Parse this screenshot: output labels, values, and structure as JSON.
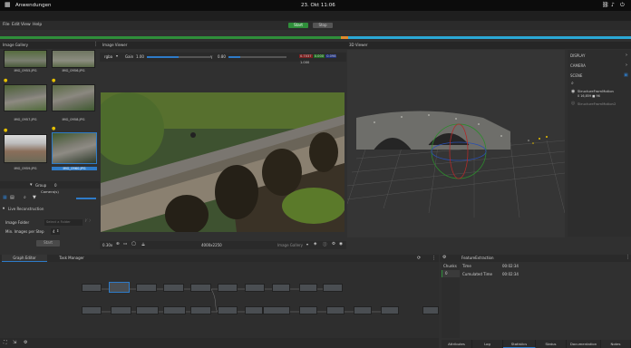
{
  "system": {
    "activities": "Anwendungen",
    "clock": "23. Okt 11:06"
  },
  "menu": [
    "File",
    "Edit",
    "View",
    "Help"
  ],
  "actions": {
    "start": "Start",
    "stop": "Stop"
  },
  "gallery": {
    "title": "Image Gallery",
    "thumbs": [
      "IMG_0955.JPG",
      "IMG_0956.JPG",
      "IMG_0957.JPG",
      "IMG_0958.JPG",
      "IMG_0959.JPG",
      "IMG_0960.JPG"
    ],
    "group_label": "Group",
    "group_value": "0",
    "camera_label": "Camera(s)"
  },
  "live": {
    "title": "Live Reconstruction",
    "image_folder_label": "Image Folder",
    "image_folder_placeholder": "Select a Folder",
    "min_images_label": "Min. Images per Step",
    "min_images_value": "4",
    "start_btn": "Start"
  },
  "viewer": {
    "title": "Image Viewer",
    "mode": "rgba",
    "gain_label": "Gain",
    "gain_value": "1.00",
    "gamma_value": "0.80",
    "pixel_values": [
      "0.7037",
      "0.000",
      "0.098",
      "1.000"
    ],
    "zoom": "0.30x",
    "resolution": "4000x2250",
    "source": "Image Gallery"
  },
  "viewer3d": {
    "title": "3D Viewer"
  },
  "scene": {
    "display": "DISPLAY",
    "camera": "CAMERA",
    "scene": "SCENE",
    "items": [
      {
        "name": "StructureFromMotion",
        "sub": "0 16,859 ■ 96"
      },
      {
        "name": "StructureFromMotion2",
        "sub": ""
      }
    ]
  },
  "graph": {
    "tabs": [
      "Graph Editor",
      "Task Manager"
    ]
  },
  "task": {
    "node_title": "FeatureExtraction",
    "side_tabs": [
      "Chunks",
      "Time",
      "Cumulated Time"
    ],
    "rows": [
      {
        "chunk": "0",
        "time": "00:02:34",
        "cumulated": "00:02:34"
      }
    ],
    "bottom_tabs": [
      "Attributes",
      "Log",
      "Statistics",
      "Status",
      "Documentation",
      "Notes"
    ],
    "active_bottom": "Statistics"
  },
  "colors": {
    "accent": "#2e7bc8",
    "start": "#2f8f3a",
    "progress": "#2ba8d6"
  }
}
